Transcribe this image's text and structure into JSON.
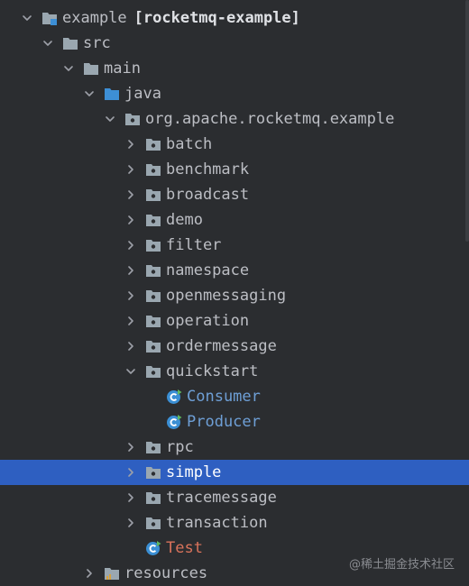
{
  "project_tree": {
    "rows": [
      {
        "name": "tree-node-example",
        "depth": 0,
        "expanded": true,
        "icon": "module-folder-icon",
        "label": "example",
        "suffix": "[rocketmq-example]",
        "kind": "module"
      },
      {
        "name": "tree-node-src",
        "depth": 1,
        "expanded": true,
        "icon": "folder-icon",
        "label": "src",
        "kind": "folder"
      },
      {
        "name": "tree-node-main",
        "depth": 2,
        "expanded": true,
        "icon": "folder-icon",
        "label": "main",
        "kind": "folder"
      },
      {
        "name": "tree-node-java",
        "depth": 3,
        "expanded": true,
        "icon": "source-root-folder-icon",
        "label": "java",
        "kind": "source-root"
      },
      {
        "name": "tree-node-org-apache-rocketmq-example",
        "depth": 4,
        "expanded": true,
        "icon": "package-icon",
        "label": "org.apache.rocketmq.example",
        "kind": "package"
      },
      {
        "name": "tree-node-batch",
        "depth": 5,
        "expanded": false,
        "icon": "package-icon",
        "label": "batch",
        "kind": "package"
      },
      {
        "name": "tree-node-benchmark",
        "depth": 5,
        "expanded": false,
        "icon": "package-icon",
        "label": "benchmark",
        "kind": "package"
      },
      {
        "name": "tree-node-broadcast",
        "depth": 5,
        "expanded": false,
        "icon": "package-icon",
        "label": "broadcast",
        "kind": "package"
      },
      {
        "name": "tree-node-demo",
        "depth": 5,
        "expanded": false,
        "icon": "package-icon",
        "label": "demo",
        "kind": "package"
      },
      {
        "name": "tree-node-filter",
        "depth": 5,
        "expanded": false,
        "icon": "package-icon",
        "label": "filter",
        "kind": "package"
      },
      {
        "name": "tree-node-namespace",
        "depth": 5,
        "expanded": false,
        "icon": "package-icon",
        "label": "namespace",
        "kind": "package"
      },
      {
        "name": "tree-node-openmessaging",
        "depth": 5,
        "expanded": false,
        "icon": "package-icon",
        "label": "openmessaging",
        "kind": "package"
      },
      {
        "name": "tree-node-operation",
        "depth": 5,
        "expanded": false,
        "icon": "package-icon",
        "label": "operation",
        "kind": "package"
      },
      {
        "name": "tree-node-ordermessage",
        "depth": 5,
        "expanded": false,
        "icon": "package-icon",
        "label": "ordermessage",
        "kind": "package"
      },
      {
        "name": "tree-node-quickstart",
        "depth": 5,
        "expanded": true,
        "icon": "package-icon",
        "label": "quickstart",
        "kind": "package"
      },
      {
        "name": "tree-node-consumer",
        "depth": 6,
        "expanded": null,
        "icon": "java-class-runnable-icon",
        "label": "Consumer",
        "kind": "class"
      },
      {
        "name": "tree-node-producer",
        "depth": 6,
        "expanded": null,
        "icon": "java-class-runnable-icon",
        "label": "Producer",
        "kind": "class"
      },
      {
        "name": "tree-node-rpc",
        "depth": 5,
        "expanded": false,
        "icon": "package-icon",
        "label": "rpc",
        "kind": "package"
      },
      {
        "name": "tree-node-simple",
        "depth": 5,
        "expanded": false,
        "icon": "package-icon",
        "label": "simple",
        "kind": "package",
        "selected": true
      },
      {
        "name": "tree-node-tracemessage",
        "depth": 5,
        "expanded": false,
        "icon": "package-icon",
        "label": "tracemessage",
        "kind": "package"
      },
      {
        "name": "tree-node-transaction",
        "depth": 5,
        "expanded": false,
        "icon": "package-icon",
        "label": "transaction",
        "kind": "package"
      },
      {
        "name": "tree-node-test",
        "depth": 5,
        "expanded": null,
        "icon": "java-class-runnable-icon",
        "label": "Test",
        "kind": "test-class"
      },
      {
        "name": "tree-node-resources",
        "depth": 3,
        "expanded": false,
        "icon": "resources-folder-icon",
        "label": "resources",
        "kind": "resources"
      }
    ]
  },
  "watermark": "@稀土掘金技术社区",
  "colors": {
    "background": "#2b2d30",
    "selection": "#2e5fc1",
    "text": "#bcbec4",
    "class_name": "#6e9fd6",
    "test_class_name": "#d9735b",
    "folder": "#9aa7b0",
    "source_root": "#3d8fd6"
  }
}
